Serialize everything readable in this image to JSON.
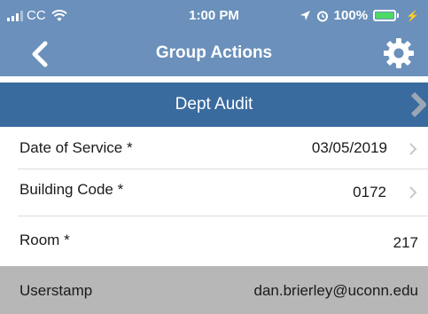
{
  "status_bar": {
    "carrier": "CC",
    "time": "1:00 PM",
    "battery": "100%",
    "battery_level": 1.0,
    "icons": [
      "signal-icon",
      "wifi-icon",
      "location-icon",
      "alarm-icon",
      "battery-icon",
      "charging-icon"
    ]
  },
  "navbar": {
    "title": "Group Actions",
    "back_icon": "chevron-left-icon",
    "settings_icon": "gear-icon"
  },
  "section": {
    "title": "Dept Audit",
    "chevron_icon": "chevron-right-icon"
  },
  "fields": [
    {
      "label": "Date of Service *",
      "value": "03/05/2019",
      "has_chevron": true
    },
    {
      "label": "Building Code *",
      "value": "0172",
      "has_chevron": true
    },
    {
      "label": "Room *",
      "value": "217",
      "has_chevron": false
    },
    {
      "label": "Userstamp",
      "value": "dan.brierley@uconn.edu",
      "has_chevron": false
    }
  ],
  "colors": {
    "header_blue": "#6a90bb",
    "section_blue": "#3a6b9f",
    "readonly_gray": "#b7b7b7",
    "battery_green": "#4cd964"
  }
}
